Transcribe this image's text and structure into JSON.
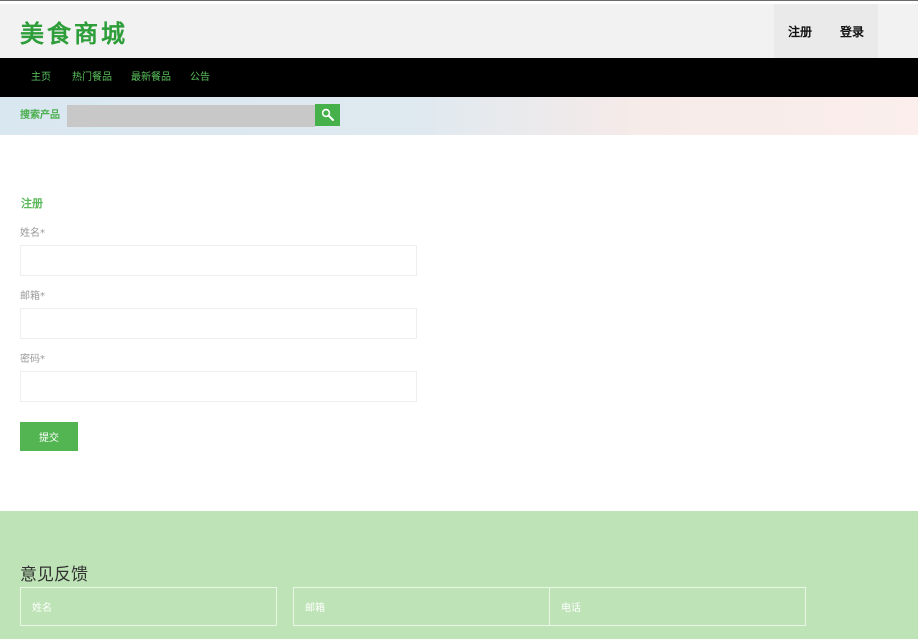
{
  "header": {
    "logo": "美食商城",
    "register_label": "注册",
    "login_label": "登录"
  },
  "nav": {
    "items": [
      {
        "label": "主页"
      },
      {
        "label": "热门餐品"
      },
      {
        "label": "最新餐品"
      },
      {
        "label": "公告"
      }
    ]
  },
  "search": {
    "label": "搜索产品",
    "value": "",
    "placeholder": "",
    "button_icon": "search-icon"
  },
  "register": {
    "title": "注册",
    "fields": [
      {
        "label": "姓名*",
        "value": ""
      },
      {
        "label": "邮箱*",
        "value": ""
      },
      {
        "label": "密码*",
        "value": ""
      }
    ],
    "submit_label": "提交"
  },
  "feedback": {
    "title": "意见反馈",
    "fields": [
      {
        "placeholder": "姓名"
      },
      {
        "placeholder": "邮箱"
      },
      {
        "placeholder": "电话"
      }
    ]
  },
  "colors": {
    "accent_green": "#4caf50",
    "nav_background": "#000000",
    "feedback_background": "#bde3b6"
  }
}
